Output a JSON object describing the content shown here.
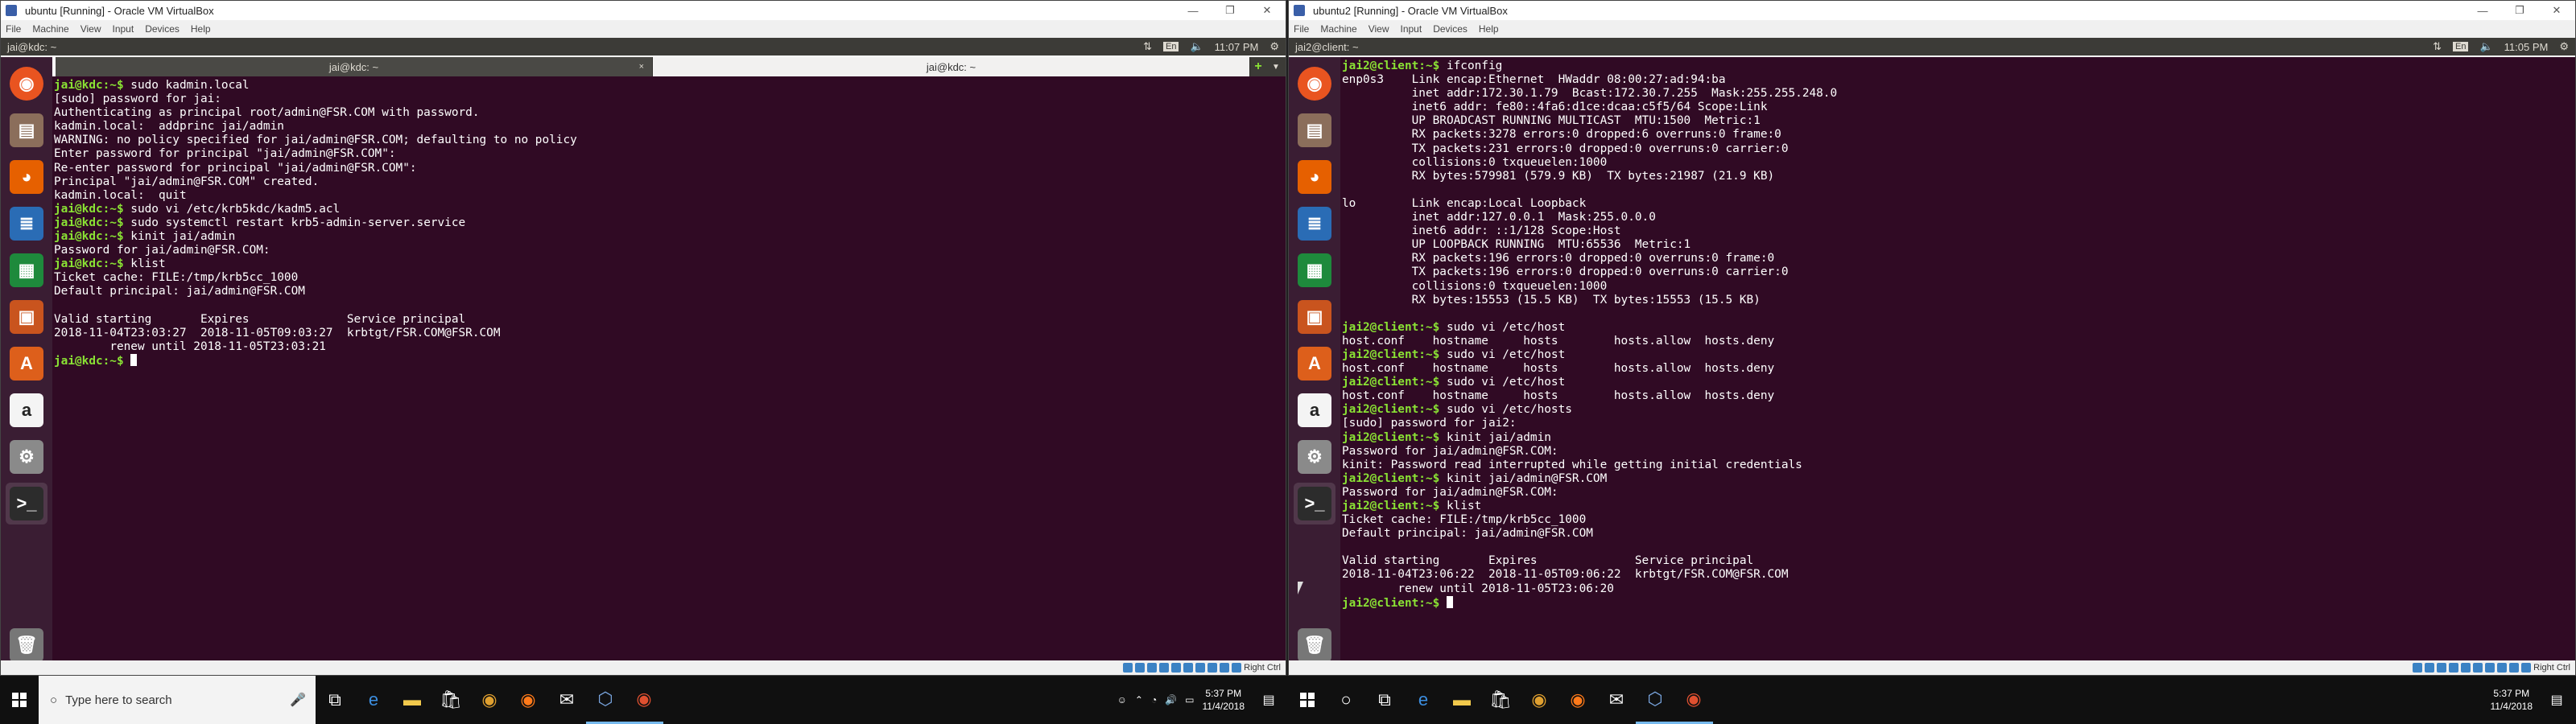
{
  "left": {
    "window_title": "ubuntu [Running] - Oracle VM VirtualBox",
    "menu": [
      "File",
      "Machine",
      "View",
      "Input",
      "Devices",
      "Help"
    ],
    "ubuntu_title": "jai@kdc: ~",
    "time": "11:07 PM",
    "kb": "En",
    "tabs": [
      "jai@kdc: ~",
      "jai@kdc: ~"
    ],
    "tab_close": "×",
    "tab_add": "+",
    "terminal": [
      {
        "p": "jai@kdc:~$",
        "t": " sudo kadmin.local"
      },
      {
        "t": "[sudo] password for jai:"
      },
      {
        "t": "Authenticating as principal root/admin@FSR.COM with password."
      },
      {
        "t": "kadmin.local:  addprinc jai/admin"
      },
      {
        "t": "WARNING: no policy specified for jai/admin@FSR.COM; defaulting to no policy"
      },
      {
        "t": "Enter password for principal \"jai/admin@FSR.COM\":"
      },
      {
        "t": "Re-enter password for principal \"jai/admin@FSR.COM\":"
      },
      {
        "t": "Principal \"jai/admin@FSR.COM\" created."
      },
      {
        "t": "kadmin.local:  quit"
      },
      {
        "p": "jai@kdc:~$",
        "t": " sudo vi /etc/krb5kdc/kadm5.acl"
      },
      {
        "p": "jai@kdc:~$",
        "t": " sudo systemctl restart krb5-admin-server.service"
      },
      {
        "p": "jai@kdc:~$",
        "t": " kinit jai/admin"
      },
      {
        "t": "Password for jai/admin@FSR.COM:"
      },
      {
        "p": "jai@kdc:~$",
        "t": " klist"
      },
      {
        "t": "Ticket cache: FILE:/tmp/krb5cc_1000"
      },
      {
        "t": "Default principal: jai/admin@FSR.COM"
      },
      {
        "t": ""
      },
      {
        "t": "Valid starting       Expires              Service principal"
      },
      {
        "t": "2018-11-04T23:03:27  2018-11-05T09:03:27  krbtgt/FSR.COM@FSR.COM"
      },
      {
        "t": "\trenew until 2018-11-05T23:03:21"
      },
      {
        "p": "jai@kdc:~$",
        "t": " ",
        "cursor": true
      }
    ],
    "status": "Right Ctrl"
  },
  "right": {
    "window_title": "ubuntu2 [Running] - Oracle VM VirtualBox",
    "menu": [
      "File",
      "Machine",
      "View",
      "Input",
      "Devices",
      "Help"
    ],
    "ubuntu_title": "jai2@client: ~",
    "time": "11:05 PM",
    "kb": "En",
    "terminal": [
      {
        "p": "jai2@client:~$",
        "t": " ifconfig"
      },
      {
        "t": "enp0s3    Link encap:Ethernet  HWaddr 08:00:27:ad:94:ba  "
      },
      {
        "t": "          inet addr:172.30.1.79  Bcast:172.30.7.255  Mask:255.255.248.0"
      },
      {
        "t": "          inet6 addr: fe80::4fa6:d1ce:dcaa:c5f5/64 Scope:Link"
      },
      {
        "t": "          UP BROADCAST RUNNING MULTICAST  MTU:1500  Metric:1"
      },
      {
        "t": "          RX packets:3278 errors:0 dropped:6 overruns:0 frame:0"
      },
      {
        "t": "          TX packets:231 errors:0 dropped:0 overruns:0 carrier:0"
      },
      {
        "t": "          collisions:0 txqueuelen:1000 "
      },
      {
        "t": "          RX bytes:579981 (579.9 KB)  TX bytes:21987 (21.9 KB)"
      },
      {
        "t": ""
      },
      {
        "t": "lo        Link encap:Local Loopback  "
      },
      {
        "t": "          inet addr:127.0.0.1  Mask:255.0.0.0"
      },
      {
        "t": "          inet6 addr: ::1/128 Scope:Host"
      },
      {
        "t": "          UP LOOPBACK RUNNING  MTU:65536  Metric:1"
      },
      {
        "t": "          RX packets:196 errors:0 dropped:0 overruns:0 frame:0"
      },
      {
        "t": "          TX packets:196 errors:0 dropped:0 overruns:0 carrier:0"
      },
      {
        "t": "          collisions:0 txqueuelen:1000 "
      },
      {
        "t": "          RX bytes:15553 (15.5 KB)  TX bytes:15553 (15.5 KB)"
      },
      {
        "t": ""
      },
      {
        "p": "jai2@client:~$",
        "t": " sudo vi /etc/host"
      },
      {
        "t": "host.conf    hostname     hosts        hosts.allow  hosts.deny"
      },
      {
        "p": "jai2@client:~$",
        "t": " sudo vi /etc/host"
      },
      {
        "t": "host.conf    hostname     hosts        hosts.allow  hosts.deny"
      },
      {
        "p": "jai2@client:~$",
        "t": " sudo vi /etc/host"
      },
      {
        "t": "host.conf    hostname     hosts        hosts.allow  hosts.deny"
      },
      {
        "p": "jai2@client:~$",
        "t": " sudo vi /etc/hosts"
      },
      {
        "t": "[sudo] password for jai2:"
      },
      {
        "p": "jai2@client:~$",
        "t": " kinit jai/admin"
      },
      {
        "t": "Password for jai/admin@FSR.COM:"
      },
      {
        "t": "kinit: Password read interrupted while getting initial credentials"
      },
      {
        "p": "jai2@client:~$",
        "t": " kinit jai/admin@FSR.COM"
      },
      {
        "t": "Password for jai/admin@FSR.COM:"
      },
      {
        "p": "jai2@client:~$",
        "t": " klist"
      },
      {
        "t": "Ticket cache: FILE:/tmp/krb5cc_1000"
      },
      {
        "t": "Default principal: jai/admin@FSR.COM"
      },
      {
        "t": ""
      },
      {
        "t": "Valid starting       Expires              Service principal"
      },
      {
        "t": "2018-11-04T23:06:22  2018-11-05T09:06:22  krbtgt/FSR.COM@FSR.COM"
      },
      {
        "t": "\trenew until 2018-11-05T23:06:20"
      },
      {
        "p": "jai2@client:~$",
        "t": " ",
        "cursor": true
      }
    ],
    "status": "Right Ctrl"
  },
  "taskbar": {
    "search_placeholder": "Type here to search",
    "time": "5:37 PM",
    "date": "11/4/2018"
  },
  "launcher_icons": [
    "ubuntu-logo-icon",
    "files-icon",
    "firefox-icon",
    "writer-icon",
    "calc-icon",
    "impress-icon",
    "software-center-icon",
    "amazon-icon",
    "settings-icon",
    "terminal-icon"
  ],
  "colors": {
    "terminal_bg": "#300a24",
    "prompt": "#8ae234",
    "launcher": "#3a1d33",
    "panel": "#3c3b37"
  }
}
